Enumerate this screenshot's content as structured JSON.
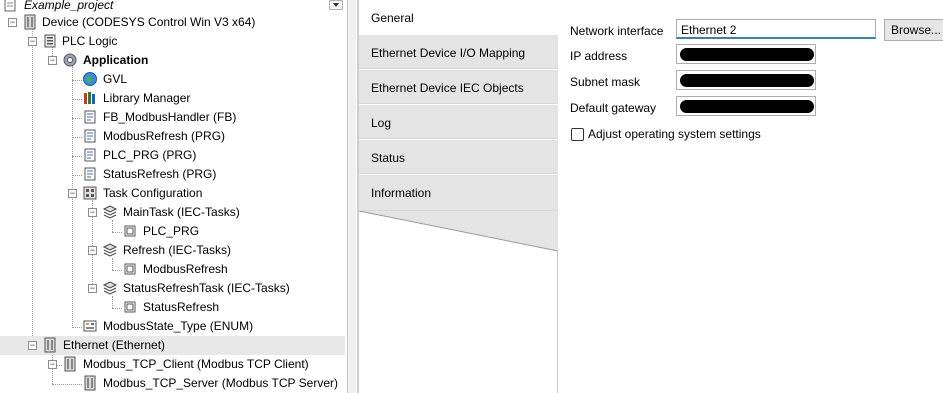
{
  "tree": {
    "items": [
      {
        "label": "Example_project",
        "icon": "project-icon"
      },
      {
        "label": "Device (CODESYS Control Win V3 x64)",
        "icon": "device-icon"
      },
      {
        "label": "PLC Logic",
        "icon": "plc-logic-icon"
      },
      {
        "label": "Application",
        "icon": "application-gear-icon"
      },
      {
        "label": "GVL",
        "icon": "gvl-globe-icon"
      },
      {
        "label": "Library Manager",
        "icon": "library-manager-icon"
      },
      {
        "label": "FB_ModbusHandler (FB)",
        "icon": "pou-icon"
      },
      {
        "label": "ModbusRefresh (PRG)",
        "icon": "pou-icon"
      },
      {
        "label": "PLC_PRG (PRG)",
        "icon": "pou-icon"
      },
      {
        "label": "StatusRefresh (PRG)",
        "icon": "pou-icon"
      },
      {
        "label": "Task Configuration",
        "icon": "task-configuration-icon"
      },
      {
        "label": "MainTask (IEC-Tasks)",
        "icon": "task-icon"
      },
      {
        "label": "PLC_PRG",
        "icon": "program-call-icon"
      },
      {
        "label": "Refresh (IEC-Tasks)",
        "icon": "task-icon"
      },
      {
        "label": "ModbusRefresh",
        "icon": "program-call-icon"
      },
      {
        "label": "StatusRefreshTask (IEC-Tasks)",
        "icon": "task-icon"
      },
      {
        "label": "StatusRefresh",
        "icon": "program-call-icon"
      },
      {
        "label": "ModbusState_Type (ENUM)",
        "icon": "dut-enum-icon"
      },
      {
        "label": "Ethernet (Ethernet)",
        "icon": "device-icon"
      },
      {
        "label": "Modbus_TCP_Client (Modbus TCP Client)",
        "icon": "device-icon"
      },
      {
        "label": "Modbus_TCP_Server (Modbus TCP Server)",
        "icon": "device-icon"
      }
    ],
    "toggle_minus": "−"
  },
  "tabs": [
    {
      "label": "General"
    },
    {
      "label": "Ethernet Device I/O Mapping"
    },
    {
      "label": "Ethernet Device IEC Objects"
    },
    {
      "label": "Log"
    },
    {
      "label": "Status"
    },
    {
      "label": "Information"
    }
  ],
  "general": {
    "network_interface_label": "Network interface",
    "network_interface_value": "Ethernet 2",
    "browse_label": "Browse...",
    "ip_address_label": "IP address",
    "subnet_mask_label": "Subnet mask",
    "default_gateway_label": "Default gateway",
    "adjust_os_settings_label": "Adjust operating system settings",
    "adjust_os_settings_checked": false
  },
  "colors": {
    "selection": "#e8e8e8",
    "tab_background": "#e4e4e4",
    "redaction": "#000000"
  }
}
